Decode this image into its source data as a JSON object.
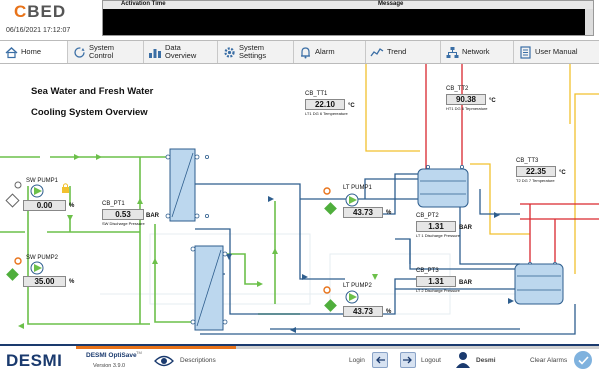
{
  "header": {
    "logo_prefix": "C",
    "logo_rest": "BED",
    "datetime": "06/16/2021 17:12:07",
    "alarm_columns": {
      "activation": "Activation Time",
      "message": "Message"
    }
  },
  "nav": {
    "tabs": [
      {
        "label": "Home",
        "icon": "home-icon",
        "active": true
      },
      {
        "label": "System Control",
        "icon": "cycle-icon"
      },
      {
        "label": "Data Overview",
        "icon": "bar-chart-icon"
      },
      {
        "label": "System Settings",
        "icon": "gear-icon"
      },
      {
        "label": "Alarm",
        "icon": "bell-icon"
      },
      {
        "label": "Trend",
        "icon": "trend-icon"
      },
      {
        "label": "Network",
        "icon": "network-icon"
      },
      {
        "label": "User Manual",
        "icon": "manual-icon"
      }
    ]
  },
  "diagram": {
    "title_line1": "Sea Water and Fresh Water",
    "title_line2": "Cooling System Overview",
    "sw_pump1": {
      "tag": "SW PUMP1",
      "value": "0.00",
      "unit": "%"
    },
    "sw_pump2": {
      "tag": "SW PUMP2",
      "value": "35.00",
      "unit": "%"
    },
    "cb_pt1": {
      "tag": "CB_PT1",
      "value": "0.53",
      "unit": "BAR",
      "sub": "SW Discharge Pressure"
    },
    "lt_pump1": {
      "tag": "LT PUMP1",
      "value": "43.73",
      "unit": "%"
    },
    "lt_pump2": {
      "tag": "LT PUMP2",
      "value": "43.73",
      "unit": "%"
    },
    "cb_tt1": {
      "tag": "CB_TT1",
      "value": "22.10",
      "unit": "°C",
      "sub": "LT1 DG 6 Tempereature"
    },
    "cb_tt2": {
      "tag": "CB_TT2",
      "value": "90.38",
      "unit": "°C",
      "sub": "HT1 DG 6 Tepmerature"
    },
    "cb_tt3": {
      "tag": "CB_TT3",
      "value": "22.35",
      "unit": "°C",
      "sub": "T2 DG 7 Temperature"
    },
    "cb_pt2": {
      "tag": "CB_PT2",
      "value": "1.31",
      "unit": "BAR",
      "sub": "LT 1 Discharge Pressure"
    },
    "cb_pt3": {
      "tag": "CB_PT3",
      "value": "1.31",
      "unit": "BAR",
      "sub": "LT 2 Discharge Pressure"
    },
    "colors": {
      "sea_water": "#6cc04a",
      "lt_water": "#2e5e8e",
      "ht_water": "#d9272e",
      "yellow": "#f2c12e"
    }
  },
  "footer": {
    "brand": "DESMI",
    "product": "DESMI OptiSave",
    "tm": "TM",
    "version": "Version 3.9.0",
    "descriptions": "Descriptions",
    "login": "Login",
    "logout": "Logout",
    "user": "Desmi",
    "clear_alarms": "Clear Alarms"
  }
}
